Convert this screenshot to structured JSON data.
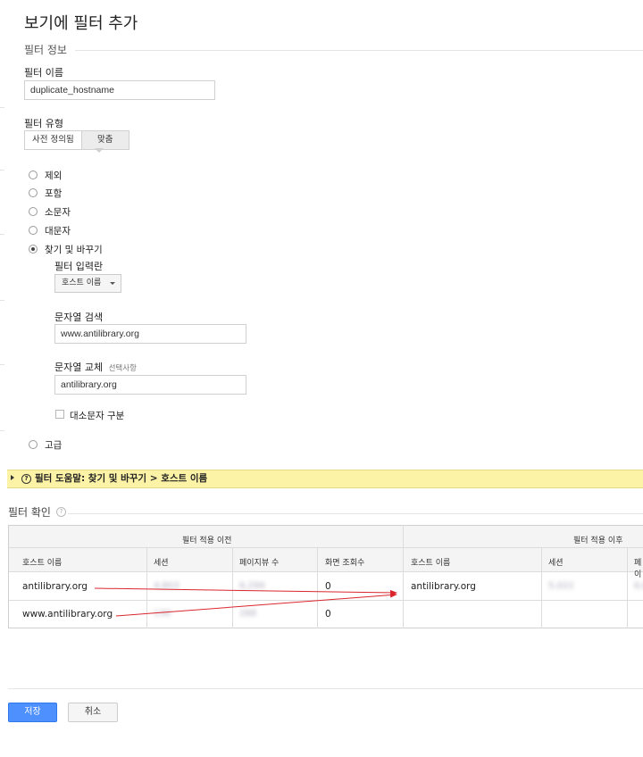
{
  "page": {
    "title": "보기에 필터 추가"
  },
  "filter_info": {
    "section_title": "필터 정보",
    "name_label": "필터 이름",
    "name_value": "duplicate_hostname"
  },
  "filter_type": {
    "label": "필터 유형",
    "tabs": [
      {
        "label": "사전 정의됨",
        "active": false
      },
      {
        "label": "맞춤",
        "active": true
      }
    ],
    "options": [
      {
        "label": "제외",
        "checked": false
      },
      {
        "label": "포함",
        "checked": false
      },
      {
        "label": "소문자",
        "checked": false
      },
      {
        "label": "대문자",
        "checked": false
      },
      {
        "label": "찾기 및 바꾸기",
        "checked": true
      }
    ],
    "advanced": {
      "label": "고급",
      "checked": false
    }
  },
  "find_replace": {
    "field_label": "필터 입력란",
    "field_value": "호스트 이름",
    "search_label": "문자열 검색",
    "search_value": "www.antilibrary.org",
    "replace_label": "문자열 교체",
    "replace_optional": "선택사항",
    "replace_value": "antilibrary.org",
    "case_label": "대소문자 구분"
  },
  "help_bar": {
    "text": "필터 도움말: 찾기 및 바꾸기 > 호스트 이름"
  },
  "verify": {
    "title": "필터 확인",
    "before_label": "필터 적용 이전",
    "after_label": "필터 적용 이후",
    "columns": [
      "호스트 이름",
      "세션",
      "페이지뷰 수",
      "화면 조회수",
      "호스트 이름",
      "세션",
      "페이"
    ],
    "rows": [
      {
        "host": "antilibrary.org",
        "sessions": "4,803",
        "pageviews": "6,299",
        "screenviews": "0",
        "after_host": "antilibrary.org",
        "after_sessions": "5,022",
        "after_pageviews": "6,6"
      },
      {
        "host": "www.antilibrary.org",
        "sessions": "130",
        "pageviews": "288",
        "screenviews": "0",
        "after_host": "",
        "after_sessions": "",
        "after_pageviews": ""
      }
    ]
  },
  "footer": {
    "save_label": "저장",
    "cancel_label": "취소"
  },
  "colors": {
    "save_button": "#4d90fe",
    "help_bar": "#fcf3a6",
    "annotation_arrow": "#d9262c"
  }
}
